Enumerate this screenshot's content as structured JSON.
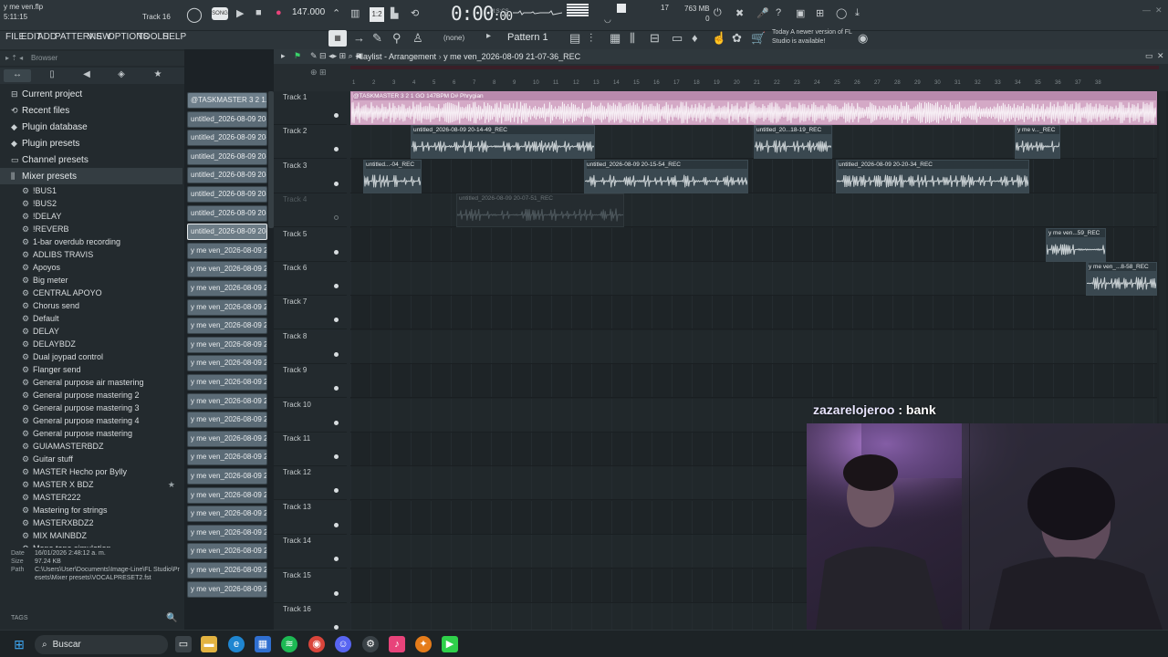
{
  "titlebar": {
    "filename": "y me ven.flp",
    "song_time": "5:11:15",
    "track_selector": "Track 16",
    "tempo": "147.000",
    "clock": "0:00",
    "clock_ms": ":00",
    "clock_unit": "M:S:CS",
    "cpu": "17",
    "memory": "763 MB",
    "polyphony": "0",
    "mode_label": "SONG"
  },
  "menu": {
    "items": [
      "FILE",
      "EDIT",
      "ADD",
      "PATTERNS",
      "VIEW",
      "OPTIONS",
      "TOOLS",
      "HELP"
    ],
    "pattern_selector": "Pattern 1",
    "preset_none": "(none)",
    "news": "Today  A newer version of FL Studio is available!"
  },
  "browser": {
    "header": "Browser",
    "categories": [
      "Current project",
      "Recent files",
      "Plugin database",
      "Plugin presets",
      "Channel presets",
      "Mixer presets"
    ],
    "presets": [
      "!BUS1",
      "!BUS2",
      "!DELAY",
      "!REVERB",
      "1-bar overdub recording",
      "ADLIBS TRAVIS",
      "Apoyos",
      "Big meter",
      "CENTRAL APOYO",
      "Chorus send",
      "Default",
      "DELAY",
      "DELAYBDZ",
      "Dual joypad control",
      "Flanger send",
      "General purpose air mastering",
      "General purpose mastering 2",
      "General purpose mastering 3",
      "General purpose mastering 4",
      "General purpose mastering",
      "GUIAMASTERBDZ",
      "Guitar stuff",
      "MASTER Hecho por Bylly",
      "MASTER X BDZ",
      "MASTER222",
      "Mastering for strings",
      "MASTERXBDZ2",
      "MIX MAINBDZ",
      "Mono tape simulation"
    ],
    "info": {
      "date_label": "Date",
      "date_value": "16/01/2026 2:48:12 a. m.",
      "size_label": "Size",
      "size_value": "97.24 KB",
      "path_label": "Path",
      "path_value": "C:\\Users\\User\\Documents\\Image-Line\\FL Studio\\Presets\\Mixer presets\\VOCALPRESET2.fst"
    },
    "tags_label": "TAGS"
  },
  "clip_list": [
    "@TASKMASTER 3 2 1...",
    "untitled_2026-08-09 20-...",
    "untitled_2026-08-09 20-...",
    "untitled_2026-08-09 20-...",
    "untitled_2026-08-09 20-...",
    "untitled_2026-08-09 20-...",
    "untitled_2026-08-09 20-...",
    "untitled_2026-08-09 20-...",
    "y me ven_2026-08-09 20...",
    "y me ven_2026-08-09 20...",
    "y me ven_2026-08-09 20...",
    "y me ven_2026-08-09 20...",
    "y me ven_2026-08-09 20...",
    "y me ven_2026-08-09 20...",
    "y me ven_2026-08-09 20...",
    "y me ven_2026-08-09 20...",
    "y me ven_2026-08-09 20...",
    "y me ven_2026-08-09 20...",
    "y me ven_2026-08-09 20...",
    "y me ven_2026-08-09 20...",
    "y me ven_2026-08-09 20...",
    "y me ven_2026-08-09 20...",
    "y me ven_2026-08-09 20...",
    "y me ven_2026-08-09 20...",
    "y me ven_2026-08-09 20...",
    "y me ven_2026-08-09 20...",
    "y me ven_2026-08-09 20..."
  ],
  "playlist": {
    "title": "Playlist - Arrangement",
    "project_clip": "y me ven_2026-08-09 21-07-36_REC",
    "ruler": [
      "1",
      "2",
      "3",
      "4",
      "5",
      "6",
      "7",
      "8",
      "9",
      "10",
      "11",
      "12",
      "13",
      "14",
      "15",
      "16",
      "17",
      "18",
      "19",
      "20",
      "21",
      "22",
      "23",
      "24",
      "25",
      "26",
      "27",
      "28",
      "29",
      "30",
      "31",
      "32",
      "33",
      "34",
      "35",
      "36",
      "37",
      "38"
    ],
    "tracks": [
      "Track 1",
      "Track 2",
      "Track 3",
      "Track 4",
      "Track 5",
      "Track 6",
      "Track 7",
      "Track 8",
      "Track 9",
      "Track 10",
      "Track 11",
      "Track 12",
      "Track 13",
      "Track 14",
      "Track 15",
      "Track 16"
    ],
    "clips": [
      {
        "label": "@TASKMASTER 3 2 1 GO 147BPM D# Phrygian",
        "kind": "pink"
      },
      {
        "label": "untitled_2026-08-09 20-14-49_REC",
        "kind": "audio"
      },
      {
        "label": "untitled_20...18-19_REC",
        "kind": "audio"
      },
      {
        "label": "y me v..._REC",
        "kind": "audio"
      },
      {
        "label": "untitled...-04_REC",
        "kind": "audio"
      },
      {
        "label": "untitled_2026-08-09 20-15-54_REC",
        "kind": "audio"
      },
      {
        "label": "untitled_2026-08-09 20-20-34_REC",
        "kind": "audio"
      },
      {
        "label": "untitled_2026-08-09 20-07-51_REC",
        "kind": "muted"
      },
      {
        "label": "y me ven...59_REC",
        "kind": "audio"
      },
      {
        "label": "y me ven_...8-58_REC",
        "kind": "audio"
      }
    ]
  },
  "overlay": {
    "chat_user": "zazarelojeroo",
    "chat_message": " : bank"
  },
  "taskbar": {
    "search_placeholder": "Buscar"
  },
  "colors": {
    "accent": "#e8437a",
    "pink_clip": "#d4a9c6",
    "audio_clip": "#3a4850",
    "fl_green": "#2fd14a"
  }
}
